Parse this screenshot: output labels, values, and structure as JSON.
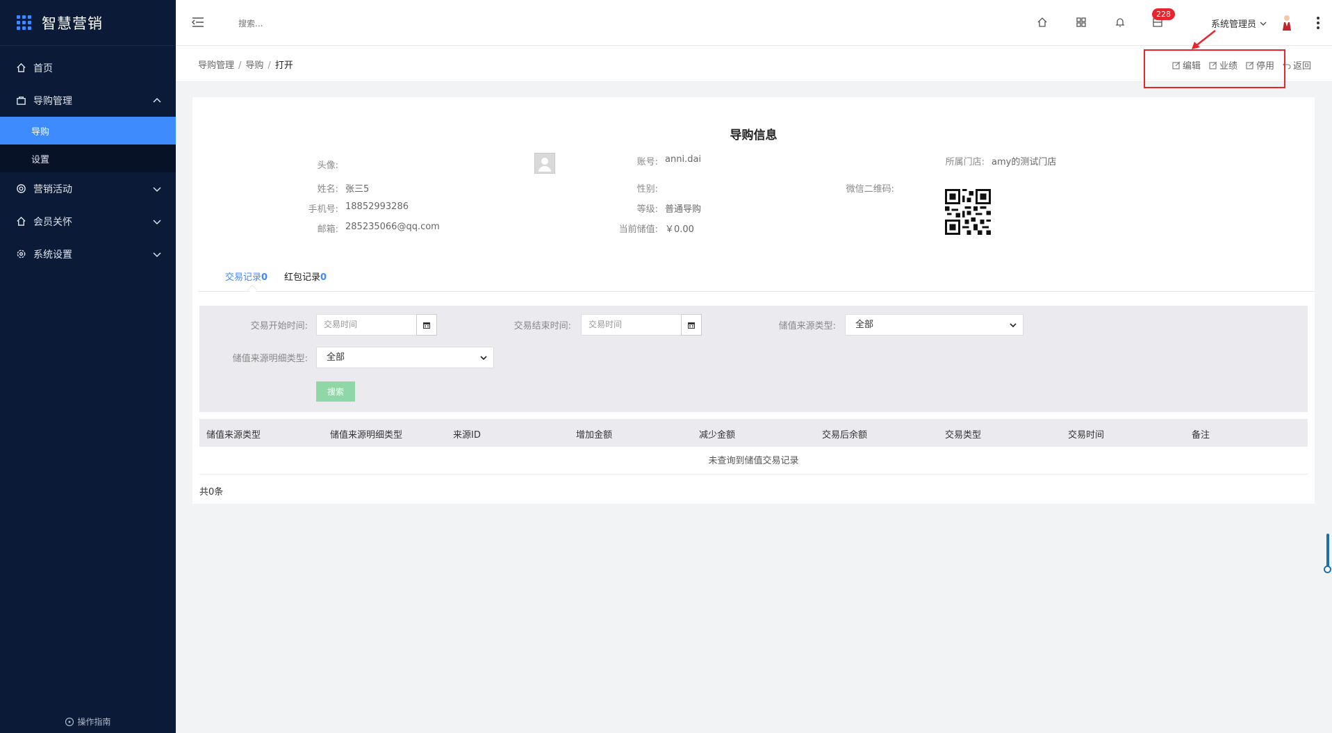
{
  "brand": {
    "name": "智慧营销"
  },
  "sidebar": {
    "items": [
      {
        "label": "首页"
      },
      {
        "label": "导购管理"
      },
      {
        "label": "营销活动"
      },
      {
        "label": "会员关怀"
      },
      {
        "label": "系统设置"
      }
    ],
    "subitems": [
      {
        "label": "导购"
      },
      {
        "label": "设置"
      }
    ],
    "guide": "操作指南"
  },
  "topbar": {
    "search_placeholder": "搜索...",
    "badge_count": "228",
    "user_name": "系统管理员"
  },
  "breadcrumb": {
    "items": [
      "导购管理",
      "导购",
      "打开"
    ]
  },
  "actions": {
    "edit": "编辑",
    "performance": "业绩",
    "disable": "停用",
    "back": "返回"
  },
  "profile": {
    "title": "导购信息",
    "avatar_label": "头像:",
    "account_label": "账号:",
    "account_value": "anni.dai",
    "store_label": "所属门店:",
    "store_value": "amy的测试门店",
    "name_label": "姓名:",
    "name_value": "张三5",
    "gender_label": "性别:",
    "gender_value": "",
    "wechat_label": "微信二维码:",
    "phone_label": "手机号:",
    "phone_value": "18852993286",
    "level_label": "等级:",
    "level_value": "普通导购",
    "email_label": "邮箱:",
    "email_value": "285235066@qq.com",
    "balance_label": "当前储值:",
    "balance_value": "￥0.00"
  },
  "tabs": [
    {
      "label": "交易记录",
      "count": "0"
    },
    {
      "label": "红包记录",
      "count": "0"
    }
  ],
  "filter": {
    "start_label": "交易开始时间:",
    "start_placeholder": "交易时间",
    "end_label": "交易结束时间:",
    "end_placeholder": "交易时间",
    "source_type_label": "储值来源类型:",
    "source_type_value": "全部",
    "source_detail_label": "储值来源明细类型:",
    "source_detail_value": "全部",
    "search_button": "搜索"
  },
  "table": {
    "columns": [
      "储值来源类型",
      "储值来源明细类型",
      "来源ID",
      "增加金额",
      "减少金额",
      "交易后余额",
      "交易类型",
      "交易时间",
      "备注"
    ],
    "empty_text": "未查询到储值交易记录",
    "total_text": "共0条"
  }
}
